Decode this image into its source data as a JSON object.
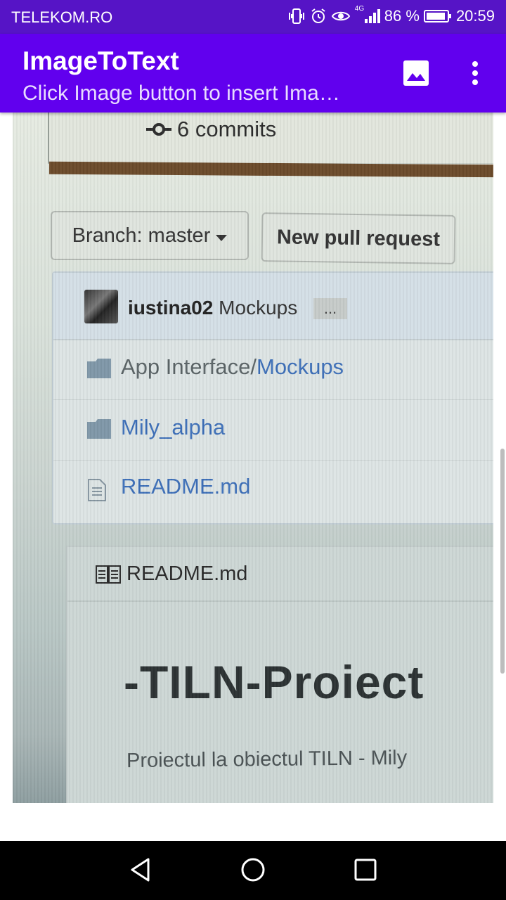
{
  "status_bar": {
    "carrier": "TELEKOM.RO",
    "network": "4G",
    "battery": "86 %",
    "time": "20:59"
  },
  "app_bar": {
    "title": "ImageToText",
    "subtitle": "Click Image button  to insert Ima…",
    "icons": [
      "image-icon",
      "more-vert-icon"
    ]
  },
  "photo": {
    "commits": "6 commits",
    "branch_button": "Branch: master",
    "new_pull_request_button": "New pull request",
    "latest_commit": {
      "user": "iustina02",
      "message": "Mockups",
      "more": "..."
    },
    "files": [
      {
        "type": "folder",
        "name_prefix": "App Interface/",
        "name_link": "Mockups"
      },
      {
        "type": "folder",
        "name_prefix": "",
        "name_link": "Mily_alpha"
      },
      {
        "type": "file",
        "name_prefix": "",
        "name_link": "README.md"
      }
    ],
    "readme_header": "README.md",
    "readme_title": "-TILN-Proiect",
    "readme_description": "Proiectul la obiectul TILN - Mily"
  },
  "nav_bar": {
    "icons": [
      "back-icon",
      "home-icon",
      "recents-icon"
    ]
  },
  "colors": {
    "status_bar": "#5614c6",
    "app_bar": "#6100ee",
    "link": "#3d6fb8"
  }
}
